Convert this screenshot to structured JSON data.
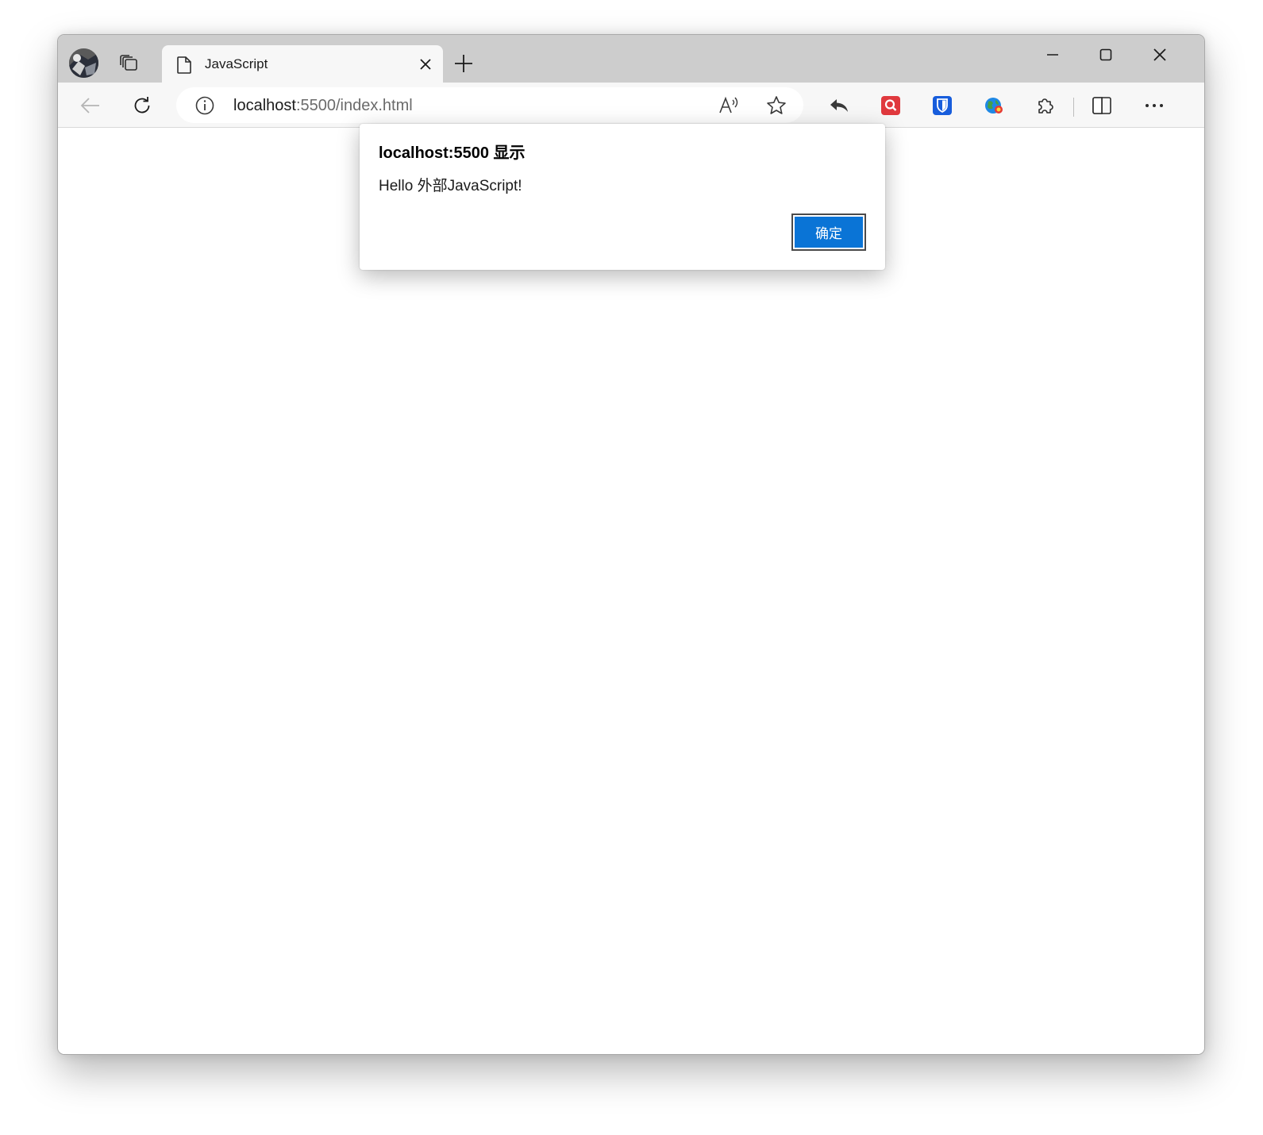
{
  "tab": {
    "title": "JavaScript"
  },
  "address_bar": {
    "host": "localhost",
    "path": ":5500/index.html"
  },
  "dialog": {
    "title": "localhost:5500 显示",
    "message": "Hello 外部JavaScript!",
    "ok_label": "确定"
  },
  "colors": {
    "tab_strip_bg": "#cdcdcd",
    "toolbar_bg": "#f7f7f7",
    "accent_button": "#0a74d6",
    "ext_red": "#e0393e",
    "ext_blue": "#175ddc"
  },
  "icons": {
    "profile": "avatar",
    "workspaces": "tab-actions-icon",
    "tab_page": "page-icon",
    "tab_close": "close-icon",
    "new_tab": "plus-icon",
    "minimize": "minimize-icon",
    "maximize": "maximize-icon",
    "close_window": "close-window-icon",
    "back": "back-arrow-icon",
    "refresh": "refresh-icon",
    "site_info": "info-icon",
    "read_aloud": "read-aloud-icon",
    "favorite": "star-icon",
    "reply": "reply-arrow-icon",
    "extension_1": "search-extension-icon",
    "extension_2": "bitwarden-shield-icon",
    "extension_3": "globe-extension-icon",
    "extensions": "puzzle-icon",
    "split_screen": "split-screen-icon",
    "more": "more-dots-icon"
  }
}
